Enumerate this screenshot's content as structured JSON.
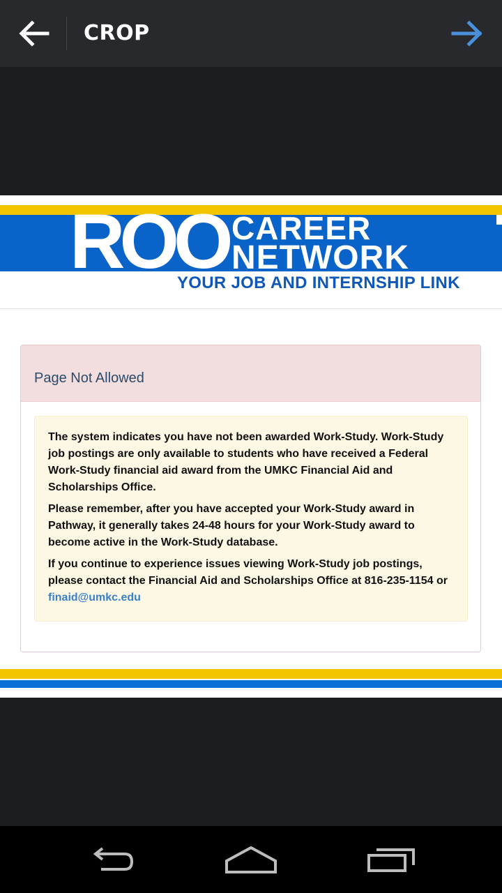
{
  "app_bar": {
    "title": "CROP",
    "back_icon": "arrow-left-icon",
    "next_icon": "arrow-right-icon",
    "accent": "#4a8fd9"
  },
  "screenshot": {
    "logo": {
      "roo": "ROO",
      "career": "CAREER",
      "network": "NETWORK",
      "tagline": "YOUR JOB AND INTERNSHIP LINK"
    },
    "panel_title": "Page Not Allowed",
    "message": {
      "p1": "The system indicates you have not been awarded Work-Study. Work-Study job postings are only available to students who have received a Federal Work-Study financial aid award from the UMKC Financial Aid and Scholarships Office.",
      "p2": "Please remember, after you have accepted your Work-Study award in Pathway, it generally takes 24-48 hours for your Work-Study award to become active in the Work-Study database.",
      "p3_text": "If you continue to experience issues viewing Work-Study job postings, please contact the Financial Aid and Scholarships Office at 816-235-1154 or ",
      "p3_link": "finaid@umkc.edu"
    },
    "colors": {
      "brand_blue": "#0a63c9",
      "brand_gold": "#f2c500",
      "link": "#3a80c9"
    }
  },
  "nav_bar": {
    "back_icon": "nav-back-icon",
    "home_icon": "nav-home-icon",
    "recents_icon": "nav-recents-icon"
  }
}
